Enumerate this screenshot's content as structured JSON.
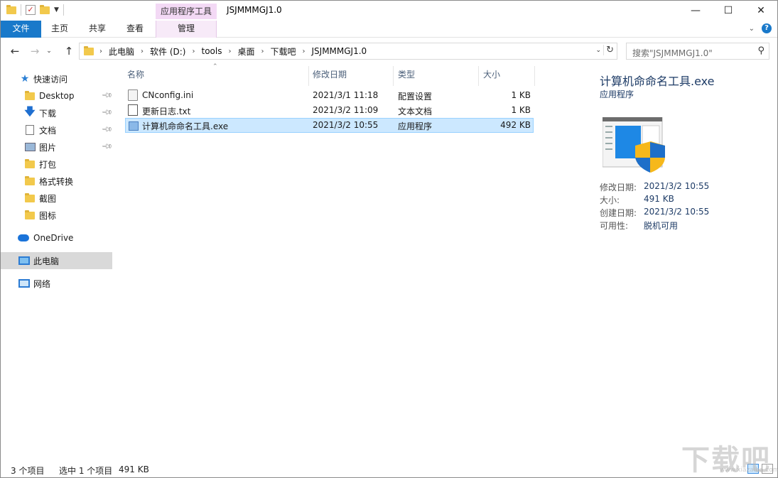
{
  "window": {
    "title": "JSJMMMGJ1.0",
    "context_tab_header": "应用程序工具",
    "controls": {
      "minimize": "—",
      "maximize": "☐",
      "close": "✕"
    }
  },
  "ribbon": {
    "tabs": [
      {
        "label": "文件"
      },
      {
        "label": "主页"
      },
      {
        "label": "共享"
      },
      {
        "label": "查看"
      },
      {
        "label": "管理"
      }
    ],
    "help": "?"
  },
  "address": {
    "breadcrumbs": [
      "此电脑",
      "软件 (D:)",
      "tools",
      "桌面",
      "下载吧",
      "JSJMMMGJ1.0"
    ],
    "search_placeholder": "搜索\"JSJMMMGJ1.0\""
  },
  "sidebar": {
    "items": [
      {
        "label": "快速访问",
        "icon": "star-icon"
      },
      {
        "label": "Desktop",
        "icon": "folder-icon",
        "pinned": true
      },
      {
        "label": "下载",
        "icon": "download-icon",
        "pinned": true
      },
      {
        "label": "文档",
        "icon": "document-icon",
        "pinned": true
      },
      {
        "label": "图片",
        "icon": "picture-icon",
        "pinned": true
      },
      {
        "label": "打包",
        "icon": "folder-icon"
      },
      {
        "label": "格式转换",
        "icon": "folder-icon"
      },
      {
        "label": "截图",
        "icon": "folder-icon"
      },
      {
        "label": "图标",
        "icon": "folder-icon"
      },
      {
        "label": "OneDrive",
        "icon": "cloud-icon"
      },
      {
        "label": "此电脑",
        "icon": "computer-icon",
        "selected": true
      },
      {
        "label": "网络",
        "icon": "network-icon"
      }
    ]
  },
  "filelist": {
    "columns": {
      "name": "名称",
      "modified": "修改日期",
      "type": "类型",
      "size": "大小"
    },
    "rows": [
      {
        "name": "CNconfig.ini",
        "modified": "2021/3/1 11:18",
        "type": "配置设置",
        "size": "1 KB",
        "icon": "ini-file-icon"
      },
      {
        "name": "更新日志.txt",
        "modified": "2021/3/2 11:09",
        "type": "文本文档",
        "size": "1 KB",
        "icon": "text-file-icon"
      },
      {
        "name": "计算机命命名工具.exe",
        "modified": "2021/3/2 10:55",
        "type": "应用程序",
        "size": "492 KB",
        "icon": "exe-file-icon",
        "selected": true
      }
    ]
  },
  "details": {
    "name": "计算机命命名工具.exe",
    "type": "应用程序",
    "props": [
      {
        "key": "修改日期:",
        "value": "2021/3/2 10:55"
      },
      {
        "key": "大小:",
        "value": "491 KB"
      },
      {
        "key": "创建日期:",
        "value": "2021/3/2 10:55"
      },
      {
        "key": "可用性:",
        "value": "脱机可用"
      }
    ]
  },
  "status": {
    "count": "3 个项目",
    "selection": "选中 1 个项目",
    "size": "491 KB"
  },
  "watermark": {
    "text": "下载吧",
    "sub": "www.xiazaiba.com"
  }
}
